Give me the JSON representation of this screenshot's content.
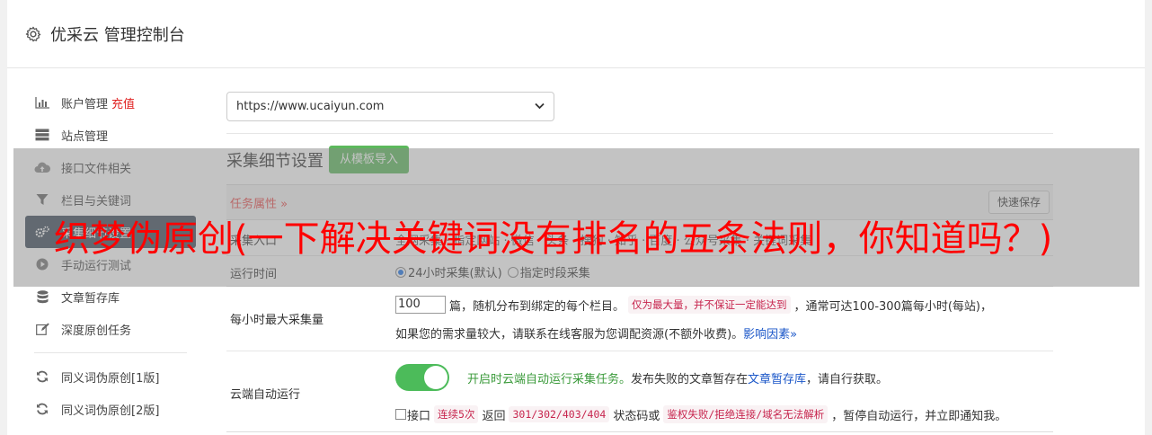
{
  "header": {
    "title": "优采云 管理控制台",
    "icon": "gear-icon"
  },
  "sidebar": {
    "items": [
      {
        "label": "账户管理",
        "extra": "充值",
        "icon": "bar-chart-icon"
      },
      {
        "label": "站点管理",
        "icon": "server-icon"
      },
      {
        "label": "接口文件相关",
        "icon": "cloud-upload-icon"
      },
      {
        "label": "栏目与关键词",
        "icon": "filter-icon"
      },
      {
        "label": "采集细节设置",
        "icon": "cogs-icon",
        "active": true
      },
      {
        "label": "手动运行测试",
        "icon": "play-icon"
      },
      {
        "label": "文章暂存库",
        "icon": "database-icon"
      },
      {
        "label": "深度原创任务",
        "icon": "edit-icon"
      },
      {
        "label": "同义词伪原创[1版]",
        "icon": "refresh-icon"
      },
      {
        "label": "同义词伪原创[2版]",
        "icon": "refresh-icon"
      }
    ]
  },
  "main": {
    "site_select": "https://www.ucaiyun.com",
    "section_title": "采集细节设置",
    "template_button": "从模板导入",
    "attr_label": "任务属性 »",
    "quick_save": "快速保存",
    "entry": {
      "label": "采集入口",
      "chips": "全网采集  ·  指定网站  ·  微信  ·  头条  ·  搜狗  ·  知乎  ·  百度  ·  公众号采集  ·  关键词采集"
    },
    "run_time": {
      "label": "运行时间",
      "opt1": "24小时采集(默认)",
      "opt2": "指定时段采集"
    },
    "max_per_hour": {
      "label": "每小时最大采集量",
      "value": "100",
      "text1": "篇，随机分布到绑定的每个栏目。",
      "code1": "仅为最大量，并不保证一定能达到",
      "text2": "，通常可达100-300篇每小时(每站)，",
      "line2": "如果您的需求量较大，请联系在线客服为您调配资源(不额外收费)。",
      "link": "影响因素»"
    },
    "auto_run": {
      "label": "云端自动运行",
      "desc_green": "开启时云端自动运行采集任务。",
      "desc_text": "发布失败的文章暂存在",
      "desc_link": "文章暂存库",
      "desc_tail": "，请自行获取。",
      "cb_label": "接口",
      "code1": "连续5次",
      "t1": "返回",
      "code2": "301/302/403/404",
      "t2": "状态码或",
      "code3": "鉴权失败/拒绝连接/域名无法解析",
      "t3": "，暂停自动运行，并立即通知我。"
    }
  },
  "overlay_headline": "织梦伪原创(一下解决关键词没有排名的五条法则，你知道吗？)"
}
